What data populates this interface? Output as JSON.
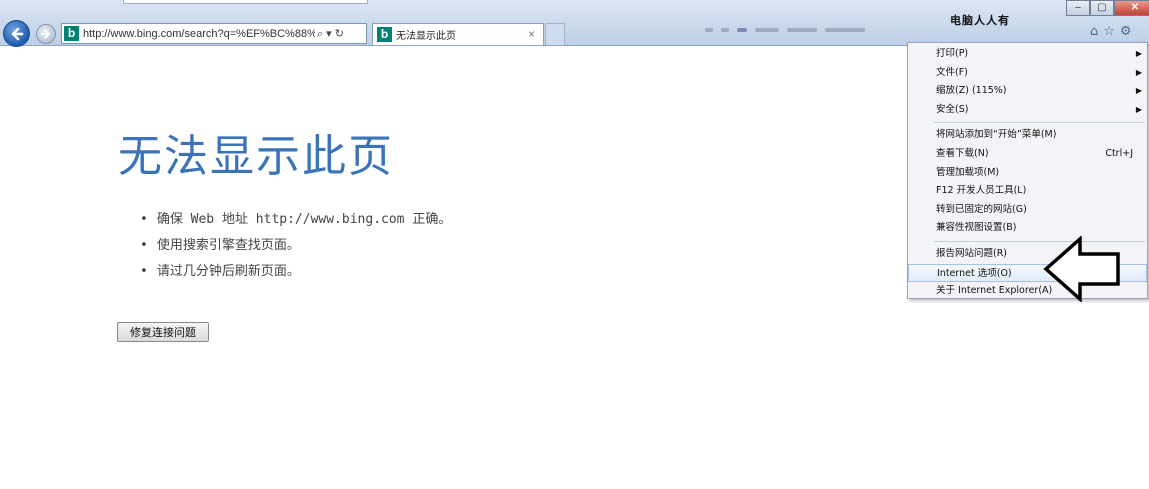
{
  "browser": {
    "url": "http://www.bing.com/search?q=%EF%BC%88%E4",
    "tab_title": "无法显示此页",
    "tab_close": "×",
    "watermark": "电脑人人有",
    "window_controls": {
      "minimize": "–",
      "maximize": "▢",
      "close": "✕"
    },
    "address_icons": {
      "search": "⌕",
      "dropdown": "▾",
      "refresh": "↻"
    },
    "tool_icons": {
      "home": "⌂",
      "favorites": "☆",
      "tools": "⚙"
    }
  },
  "page": {
    "title": "无法显示此页",
    "tips": [
      "确保 Web 地址 http://www.bing.com 正确。",
      "使用搜索引擎查找页面。",
      "请过几分钟后刷新页面。"
    ],
    "fix_button": "修复连接问题"
  },
  "tools_menu": {
    "groups": [
      [
        {
          "label": "打印(P)",
          "submenu": true
        },
        {
          "label": "文件(F)",
          "submenu": true
        },
        {
          "label": "缩放(Z) (115%)",
          "submenu": true
        },
        {
          "label": "安全(S)",
          "submenu": true
        }
      ],
      [
        {
          "label": "将网站添加到“开始”菜单(M)"
        },
        {
          "label": "查看下载(N)",
          "shortcut": "Ctrl+J"
        },
        {
          "label": "管理加载项(M)"
        },
        {
          "label": "F12 开发人员工具(L)"
        },
        {
          "label": "转到已固定的网站(G)"
        },
        {
          "label": "兼容性视图设置(B)"
        }
      ],
      [
        {
          "label": "报告网站问题(R)"
        },
        {
          "label": "Internet 选项(O)",
          "highlighted": true
        },
        {
          "label": "关于 Internet Explorer(A)"
        }
      ]
    ],
    "submenu_arrow": "▶"
  },
  "colors": {
    "title_blue": "#3a73b8",
    "chrome_blue": "#c8d8ec",
    "bing_green": "#008373"
  }
}
